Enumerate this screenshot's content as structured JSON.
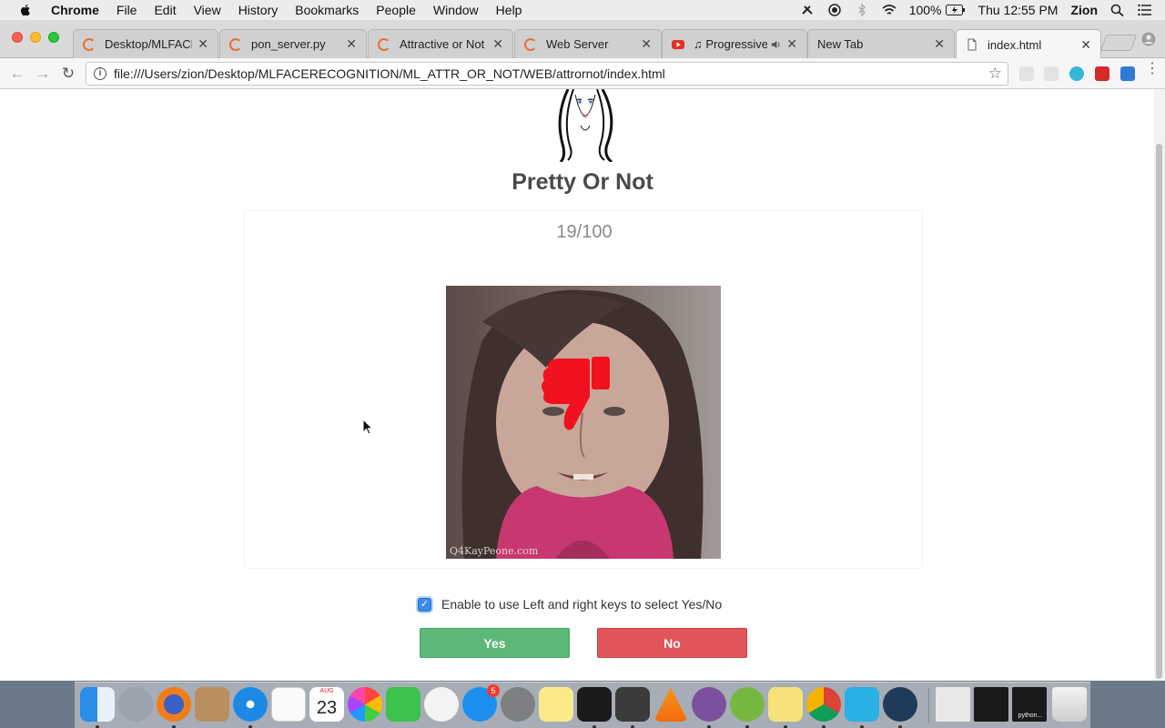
{
  "menubar": {
    "items": [
      "Chrome",
      "File",
      "Edit",
      "View",
      "History",
      "Bookmarks",
      "People",
      "Window",
      "Help"
    ],
    "battery": "100%",
    "clock": "Thu 12:55 PM",
    "user": "Zion"
  },
  "tabs": [
    {
      "label": "Desktop/MLFACER",
      "icon": "loading-spinner-icon"
    },
    {
      "label": "pon_server.py",
      "icon": "loading-spinner-icon"
    },
    {
      "label": "Attractive or Not",
      "icon": "loading-spinner-icon"
    },
    {
      "label": "Web Server",
      "icon": "loading-spinner-icon"
    },
    {
      "label": "♫ Progressive T",
      "icon": "youtube-icon"
    },
    {
      "label": "New Tab",
      "icon": ""
    },
    {
      "label": "index.html",
      "icon": "document-icon"
    }
  ],
  "address_bar": {
    "url": "file:///Users/zion/Desktop/MLFACERECOGNITION/ML_ATTR_OR_NOT/WEB/attrornot/index.html"
  },
  "page": {
    "title": "Pretty Or Not",
    "counter": "19/100",
    "watermark": "Q4KayPeone.com",
    "verdict_icon": "thumbs-down-icon",
    "checkbox_checked": true,
    "checkbox_label": "Enable to use Left and right keys to select Yes/No",
    "yes_label": "Yes",
    "no_label": "No"
  },
  "dock": {
    "calendar_month": "AUG",
    "calendar_day": "23",
    "appstore_badge": "5",
    "python_label": "python..."
  },
  "colors": {
    "yes": "#5cb878",
    "no": "#e1545a",
    "thumb": "#f2111e",
    "checkbox": "#3d8be8"
  }
}
